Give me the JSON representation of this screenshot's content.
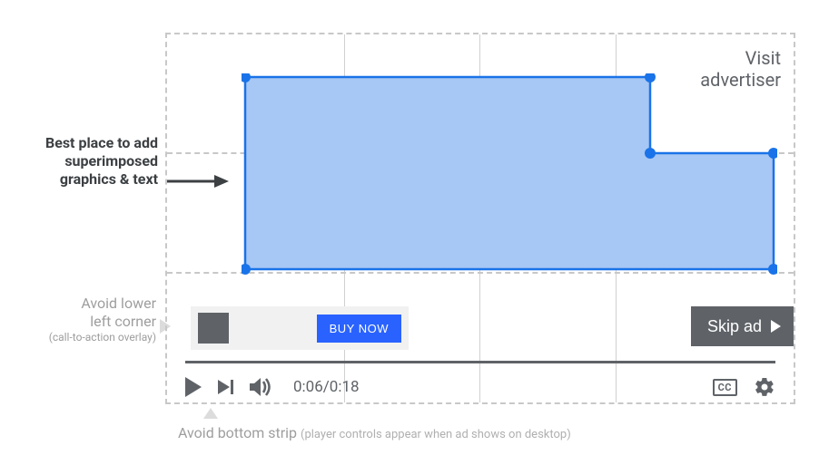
{
  "labels": {
    "best_place": "Best place to add superimposed graphics & text",
    "avoid_lower_left_line1": "Avoid lower",
    "avoid_lower_left_line2": "left corner",
    "avoid_lower_left_sub": "(call-to-action overlay)",
    "avoid_bottom": "Avoid bottom strip",
    "avoid_bottom_sub": "(player controls appear when ad shows on desktop)"
  },
  "player": {
    "visit_line1": "Visit",
    "visit_line2": "advertiser",
    "cta_button": "BUY NOW",
    "skip_ad": "Skip ad",
    "time_current": "0:06",
    "time_total": "0:18",
    "cc": "CC"
  },
  "colors": {
    "safe_fill": "#a7c7f4",
    "safe_stroke": "#1a73e8",
    "accent": "#2962ff",
    "muted": "#5f6368",
    "dash": "#c8c8c8"
  }
}
